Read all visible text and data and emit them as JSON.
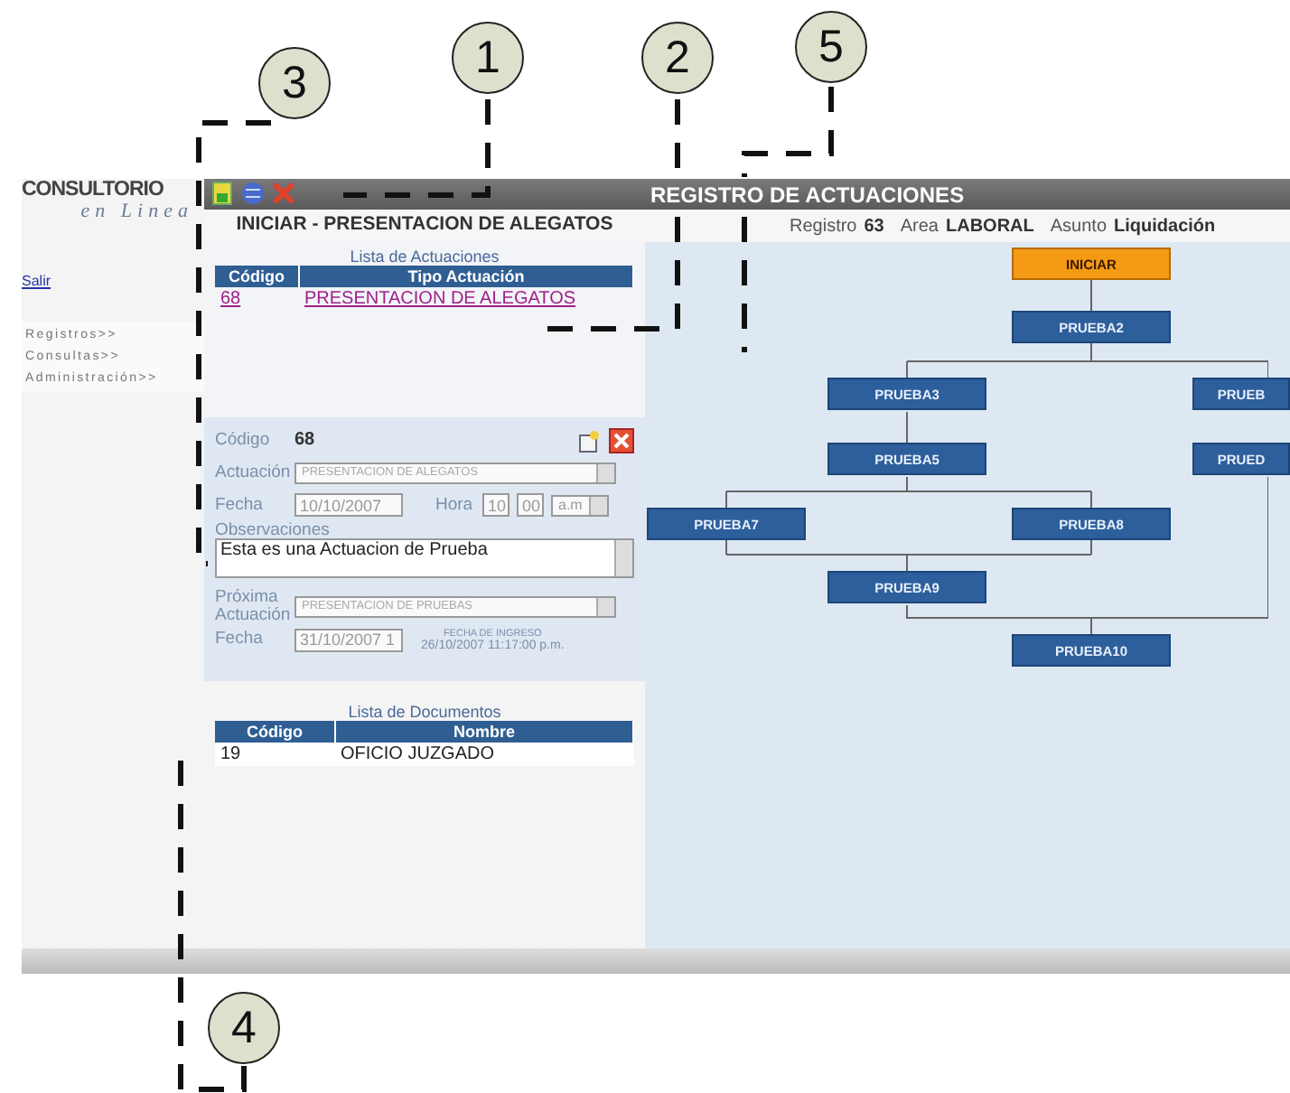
{
  "sidebar": {
    "logo_title": "CONSULTORIO",
    "logo_subtitle": "en Linea",
    "logout_link": "Salir",
    "menu": [
      "Registros>>",
      "Consultas>>",
      "Administración>>"
    ]
  },
  "toolbar": {
    "title": "REGISTRO DE ACTUACIONES"
  },
  "left_panel": {
    "heading": "INICIAR - PRESENTACION DE ALEGATOS",
    "actuaciones": {
      "title": "Lista de Actuaciones",
      "columns": [
        "Código",
        "Tipo Actuación"
      ],
      "rows": [
        [
          "68",
          "PRESENTACION DE ALEGATOS"
        ]
      ]
    },
    "form": {
      "codigo_label": "Código",
      "codigo": "68",
      "actuacion_label": "Actuación",
      "actuacion": "PRESENTACION DE ALEGATOS",
      "fecha_label": "Fecha",
      "fecha": "10/10/2007",
      "hora_label": "Hora",
      "hora": "10",
      "minutos": "00",
      "ampm": "a.m",
      "observaciones_label": "Observaciones",
      "observaciones": "Esta es una Actuacion de Prueba",
      "proxima_label": "Próxima Actuación",
      "proxima": "PRESENTACION DE PRUEBAS",
      "fecha2_label": "Fecha",
      "fecha2": "31/10/2007 1",
      "ingreso_label": "FECHA DE INGRESO",
      "ingreso": "26/10/2007 11:17:00 p.m."
    },
    "documentos": {
      "title": "Lista de Documentos",
      "columns": [
        "Código",
        "Nombre"
      ],
      "rows": [
        [
          "19",
          "OFICIO JUZGADO"
        ]
      ]
    }
  },
  "right_panel": {
    "registro_label": "Registro",
    "registro": "63",
    "area_label": "Area",
    "area": "LABORAL",
    "asunto_label": "Asunto",
    "asunto": "Liquidación",
    "nodes": [
      {
        "label": "INICIAR",
        "kind": "start"
      },
      {
        "label": "PRUEBA2",
        "kind": "step"
      },
      {
        "label": "PRUEBA3",
        "kind": "step"
      },
      {
        "label": "PRUEB",
        "kind": "step"
      },
      {
        "label": "PRUEBA5",
        "kind": "step"
      },
      {
        "label": "PRUED",
        "kind": "step"
      },
      {
        "label": "PRUEBA7",
        "kind": "step"
      },
      {
        "label": "PRUEBA8",
        "kind": "step"
      },
      {
        "label": "PRUEBA9",
        "kind": "step"
      },
      {
        "label": "PRUEBA10",
        "kind": "step"
      }
    ]
  },
  "callouts": [
    "1",
    "2",
    "3",
    "4",
    "5"
  ]
}
